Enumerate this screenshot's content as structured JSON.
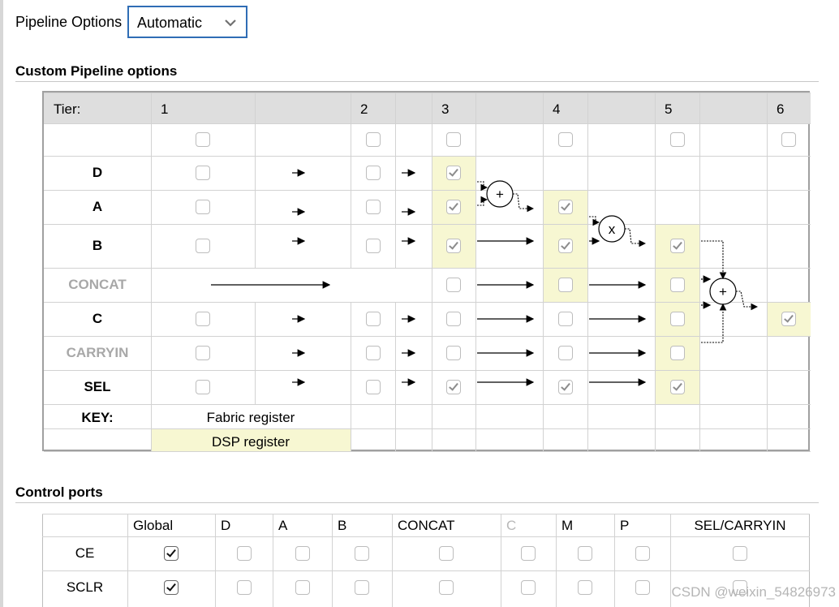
{
  "pipeline": {
    "label": "Pipeline Options",
    "selected": "Automatic"
  },
  "custom": {
    "title": "Custom Pipeline options",
    "tier_label": "Tier:",
    "tiers": [
      "1",
      "2",
      "3",
      "4",
      "5",
      "6"
    ],
    "rows": [
      {
        "label": "D",
        "disabled": false
      },
      {
        "label": "A",
        "disabled": false
      },
      {
        "label": "B",
        "disabled": false
      },
      {
        "label": "CONCAT",
        "disabled": true
      },
      {
        "label": "C",
        "disabled": false
      },
      {
        "label": "CARRYIN",
        "disabled": true
      },
      {
        "label": "SEL",
        "disabled": false
      }
    ],
    "key_label": "KEY:",
    "fabric_label": "Fabric register",
    "dsp_label": "DSP register",
    "ops": {
      "add": "+",
      "mult": "x"
    }
  },
  "control": {
    "title": "Control ports",
    "columns": [
      "Global",
      "D",
      "A",
      "B",
      "CONCAT",
      "C",
      "M",
      "P",
      "SEL/CARRYIN"
    ],
    "rows": [
      {
        "label": "CE",
        "global_checked": true
      },
      {
        "label": "SCLR",
        "global_checked": true
      }
    ]
  },
  "watermark": "CSDN @weixin_54826973",
  "colors": {
    "dsp_register": "#f7f7d2",
    "select_border": "#2f6db5"
  }
}
